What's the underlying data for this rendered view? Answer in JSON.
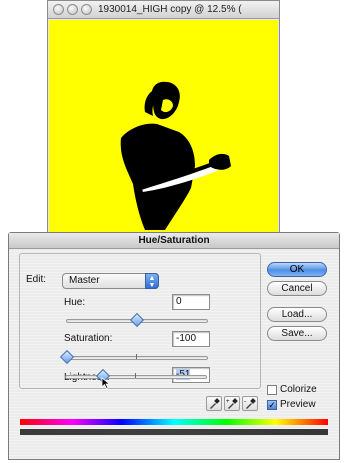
{
  "document": {
    "title": "1930014_HIGH copy @ 12.5% (",
    "canvas_color": "#ffff00"
  },
  "dialog": {
    "title": "Hue/Saturation",
    "edit_label": "Edit:",
    "edit_value": "Master",
    "hue": {
      "label": "Hue:",
      "value": "0"
    },
    "saturation": {
      "label": "Saturation:",
      "value": "-100"
    },
    "lightness": {
      "label": "Lightness:",
      "value": "-51"
    },
    "buttons": {
      "ok": "OK",
      "cancel": "Cancel",
      "load": "Load...",
      "save": "Save..."
    },
    "colorize": {
      "label": "Colorize",
      "checked": false
    },
    "preview": {
      "label": "Preview",
      "checked": true
    }
  }
}
